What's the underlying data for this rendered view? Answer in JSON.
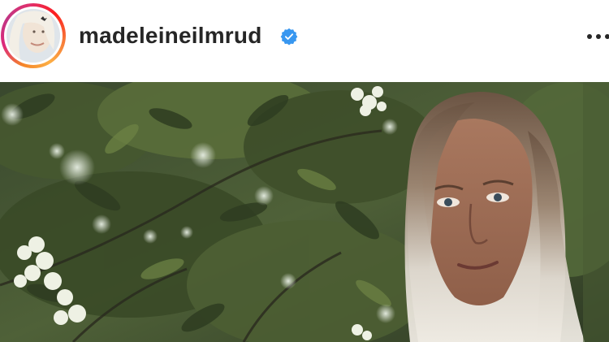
{
  "post": {
    "username": "madeleineilmrud",
    "verified": true,
    "icons": {
      "avatar": "profile-avatar",
      "verified": "verified-badge-icon",
      "more": "more-options-icon"
    },
    "colors": {
      "username": "#262626",
      "verified_badge": "#3897f0",
      "story_ring": [
        "#f58529",
        "#dd2a7b",
        "#fcaf45"
      ]
    },
    "media": {
      "type": "photo"
    }
  }
}
